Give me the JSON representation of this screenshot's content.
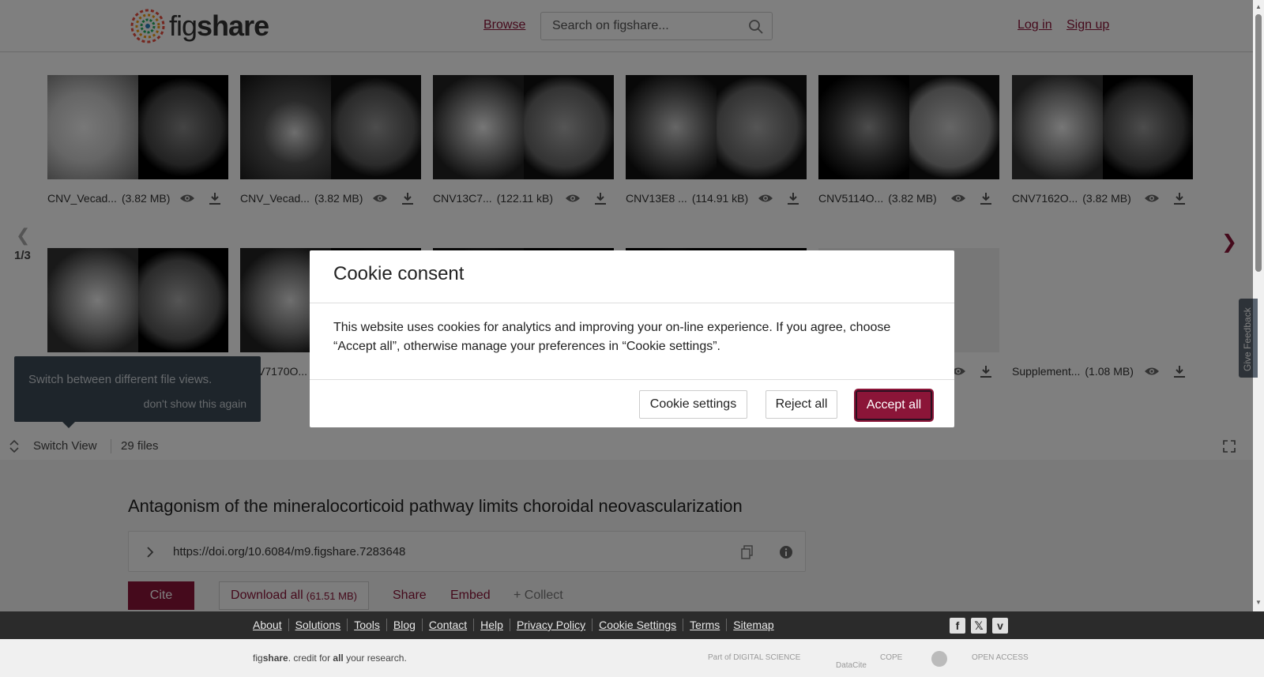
{
  "header": {
    "logo_text_light": "fig",
    "logo_text_bold": "share",
    "browse": "Browse",
    "search_placeholder": "Search on figshare...",
    "login": "Log in",
    "signup": "Sign up"
  },
  "gallery": {
    "page_indicator": "1/3",
    "files": [
      {
        "name": "CNV_Vecad...",
        "size": "(3.82 MB)"
      },
      {
        "name": "CNV_Vecad...",
        "size": "(3.82 MB)"
      },
      {
        "name": "CNV13C7...",
        "size": "(122.11 kB)"
      },
      {
        "name": "CNV13E8 ...",
        "size": "(114.91 kB)"
      },
      {
        "name": "CNV5114O...",
        "size": "(3.82 MB)"
      },
      {
        "name": "CNV7162O...",
        "size": "(3.82 MB)"
      },
      {
        "name": "V7170O...",
        "size": ""
      },
      {
        "name": "Supplement...",
        "size": "(1.08 MB)"
      }
    ]
  },
  "tooltip": {
    "text": "Switch between different file views.",
    "dismiss": "don't show this again"
  },
  "switch_bar": {
    "label": "Switch View",
    "file_count": "29 files"
  },
  "article": {
    "title": "Antagonism of the mineralocorticoid pathway limits choroidal neovascularization",
    "doi": "https://doi.org/10.6084/m9.figshare.7283648",
    "cite": "Cite",
    "download_all": "Download all",
    "download_size": "(61.51 MB)",
    "share": "Share",
    "embed": "Embed",
    "collect": "+ Collect"
  },
  "footer": {
    "links": [
      "About",
      "Solutions",
      "Tools",
      "Blog",
      "Contact",
      "Help",
      "Privacy Policy",
      "Cookie Settings",
      "Terms",
      "Sitemap"
    ],
    "tagline_fig": "fig",
    "tagline_share": "share",
    "tagline_mid": ". credit for ",
    "tagline_all": "all",
    "tagline_end": " your research.",
    "partner_digital_science": "Part of DIGITAL SCIENCE",
    "partner_datacite": "DataCite",
    "partner_cope": "COPE",
    "partner_open_access": "OPEN ACCESS"
  },
  "feedback": "Give Feedback",
  "cookie_modal": {
    "title": "Cookie consent",
    "body": "This website uses cookies for analytics and improving your on-line experience. If you agree, choose “Accept all”, otherwise manage your preferences in “Cookie settings”.",
    "settings": "Cookie settings",
    "reject": "Reject all",
    "accept": "Accept all"
  },
  "colors": {
    "brand": "#8b1538",
    "footer_bg": "#2b2b2b",
    "tooltip_bg": "#3d4a56"
  }
}
